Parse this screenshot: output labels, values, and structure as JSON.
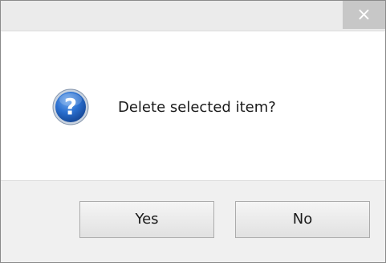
{
  "titlebar": {
    "title": "",
    "close_glyph": "×"
  },
  "message": {
    "icon": "question-icon",
    "text": "Delete selected item?"
  },
  "buttons": {
    "yes_label": "Yes",
    "no_label": "No"
  },
  "colors": {
    "icon_blue": "#1f5fb8",
    "close_bg": "#c7c7c7",
    "footer_bg": "#f0f0f0"
  }
}
